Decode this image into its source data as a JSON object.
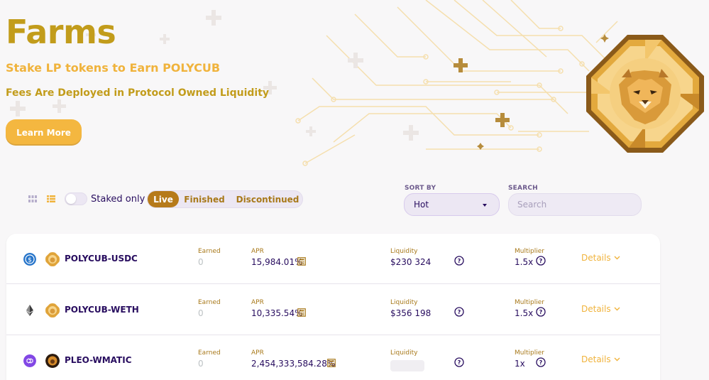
{
  "hero": {
    "title": "Farms",
    "subtitle_1": "Stake LP tokens to Earn POLYCUB",
    "subtitle_2": "Fees Are Deployed in Protocol Owned Liquidity",
    "learn_more_label": "Learn More"
  },
  "controls": {
    "staked_only_label": "Staked only",
    "staked_only_checked": false,
    "active_view": "list",
    "tabs": [
      {
        "label": "Live",
        "active": true
      },
      {
        "label": "Finished",
        "active": false
      },
      {
        "label": "Discontinued",
        "active": false
      }
    ],
    "sort_by_label": "SORT BY",
    "sort_value": "Hot",
    "search_label": "SEARCH",
    "search_placeholder": "Search"
  },
  "table": {
    "headers": {
      "earned": "Earned",
      "apr": "APR",
      "liquidity": "Liquidity",
      "multiplier": "Multiplier",
      "details": "Details"
    },
    "rows": [
      {
        "pair": "POLYCUB-USDC",
        "earned": "0",
        "apr": "15,984.01%",
        "liquidity": "$230 324",
        "multiplier": "1.5x",
        "token_a": "usdc-icon",
        "token_b": "polycub-icon"
      },
      {
        "pair": "POLYCUB-WETH",
        "earned": "0",
        "apr": "10,335.54%",
        "liquidity": "$356 198",
        "multiplier": "1.5x",
        "token_a": "eth-icon",
        "token_b": "polycub-icon"
      },
      {
        "pair": "PLEO-WMATIC",
        "earned": "0",
        "apr": "2,454,333,584.28%",
        "liquidity": "",
        "multiplier": "1x",
        "token_a": "matic-icon",
        "token_b": "pleo-icon"
      }
    ]
  },
  "colors": {
    "gold": "#c29c1b",
    "orange": "#f0b33c",
    "brown": "#b67a1a",
    "text": "#280d5f"
  }
}
